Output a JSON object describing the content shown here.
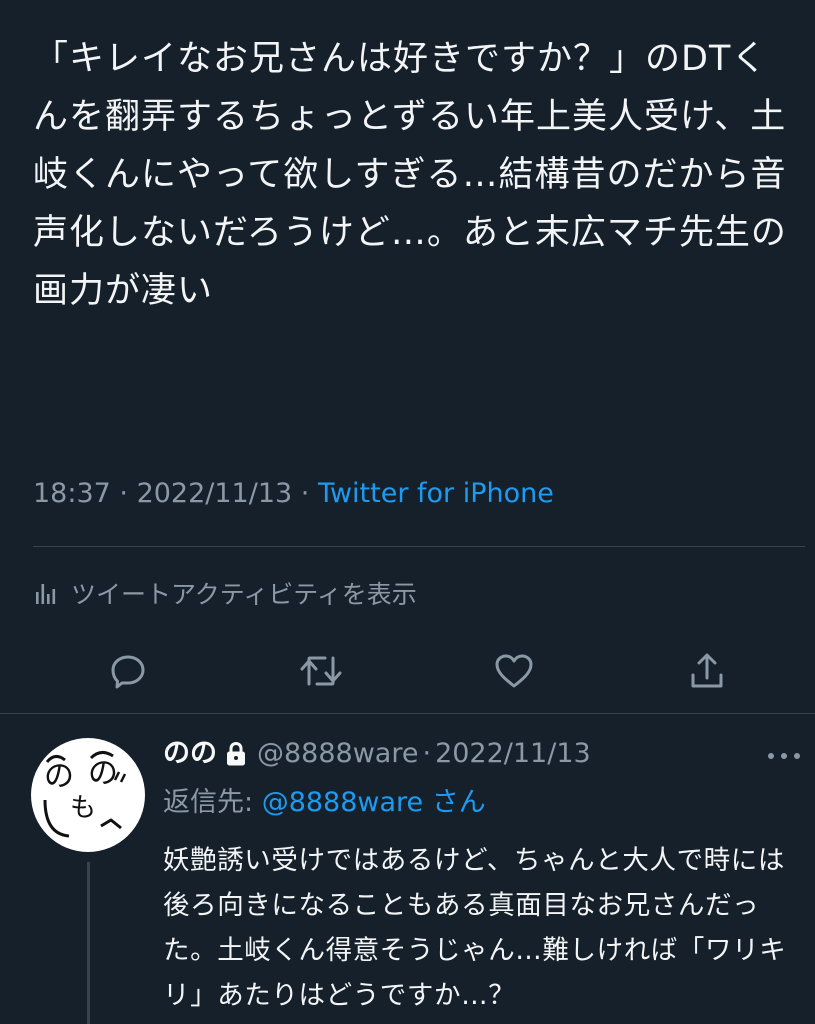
{
  "tweet": {
    "text": "「キレイなお兄さんは好きですか？」のDTくんを翻弄するちょっとずるい年上美人受け、土岐くんにやって欲しすぎる…結構昔のだから音声化しないだろうけど…。あと末広マチ先生の画力が凄い",
    "time": "18:37",
    "dot1": " · ",
    "date": "2022/11/13",
    "dot2": " · ",
    "source": "Twitter for iPhone",
    "activity_label": "ツイートアクティビティを表示"
  },
  "actions": {
    "reply_icon": "reply-icon",
    "retweet_icon": "retweet-icon",
    "like_icon": "heart-icon",
    "share_icon": "share-icon"
  },
  "reply": {
    "name": "のの",
    "handle": "@8888ware",
    "separator": "·",
    "date": "2022/11/13",
    "reply_to_prefix": "返信先: ",
    "reply_to_mention": "@8888ware",
    "reply_to_suffix": " さん",
    "text": "妖艶誘い受けではあるけど、ちゃんと大人で時には後ろ向きになることもある真面目なお兄さんだった。土岐くん得意そうじゃん…難しければ「ワリキリ」あたりはどうですか…？",
    "avatar_chars": [
      "の",
      "の",
      "も"
    ]
  },
  "colors": {
    "background": "#15202b",
    "text": "#f7f9f9",
    "muted": "#8b98a5",
    "accent": "#1d9bf0",
    "divider": "#38444d"
  }
}
